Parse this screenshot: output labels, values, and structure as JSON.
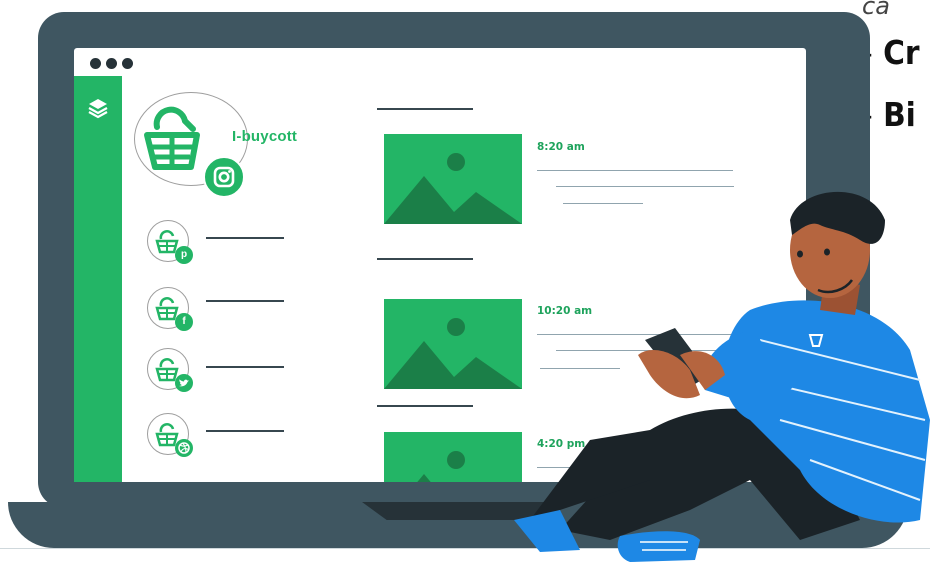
{
  "top_right_partial_text": "ca",
  "feature_lines": [
    {
      "dash": "-",
      "text": "Cr"
    },
    {
      "dash": "-",
      "text": "Bi"
    }
  ],
  "brand": {
    "name": "I-buycott",
    "primary_color": "#23b566"
  },
  "window_controls": [
    "dot",
    "dot",
    "dot"
  ],
  "sidebar": {
    "icon": "layers-icon"
  },
  "social_accounts": [
    {
      "icon": "basket-icon",
      "badge": "pinterest-icon",
      "badge_glyph": "p"
    },
    {
      "icon": "basket-icon",
      "badge": "facebook-icon",
      "badge_glyph": "f"
    },
    {
      "icon": "basket-icon",
      "badge": "twitter-icon",
      "badge_glyph": "🐦"
    },
    {
      "icon": "basket-icon",
      "badge": "dribbble-icon",
      "badge_glyph": "⊕"
    }
  ],
  "main_profile": {
    "badge": "instagram-icon"
  },
  "posts": [
    {
      "time": "8:20 am",
      "image": "image-placeholder-icon"
    },
    {
      "time": "10:20 am",
      "image": "image-placeholder-icon"
    },
    {
      "time": "4:20 pm",
      "image": "image-placeholder-icon"
    }
  ],
  "colors": {
    "laptop": "#3f5661",
    "accent": "#23b566",
    "shirt": "#1e88e5",
    "pants": "#1b2328",
    "skin": "#b5653f"
  }
}
